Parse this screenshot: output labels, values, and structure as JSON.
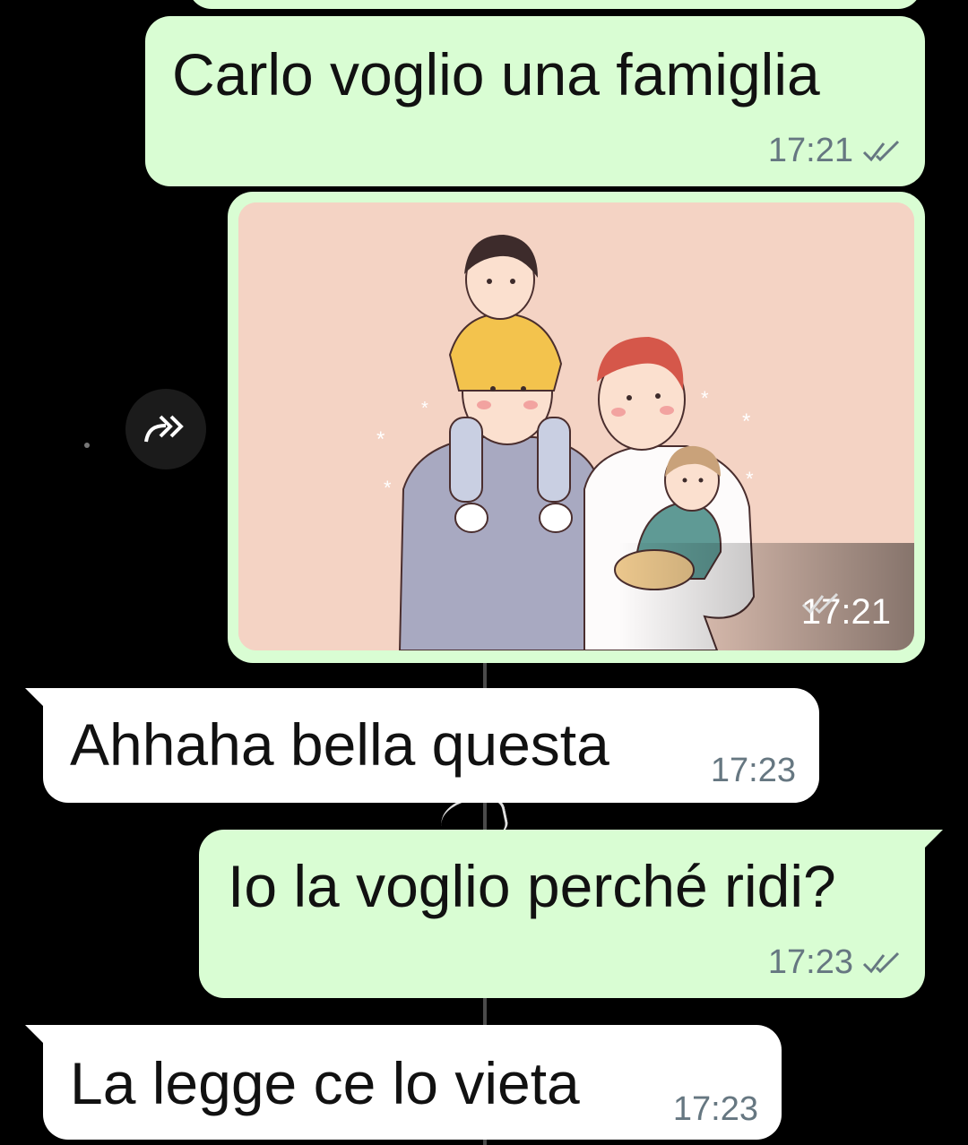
{
  "colors": {
    "background": "#000000",
    "outgoing_bubble": "#d9fdd3",
    "incoming_bubble": "#ffffff",
    "tick": "#667781"
  },
  "messages": [
    {
      "text": "Carlo voglio una famiglia",
      "time": "17:21"
    },
    {
      "image_icon": "family-illustration-image",
      "time": "17:21"
    },
    {
      "text": "Ahhaha bella questa",
      "time": "17:23"
    },
    {
      "text": "Io la voglio perché ridi?",
      "time": "17:23"
    },
    {
      "text": "La legge ce lo vieta",
      "time": "17:23"
    }
  ],
  "icons": {
    "forward": "forward-icon",
    "read_receipt": "double-check-icon"
  }
}
